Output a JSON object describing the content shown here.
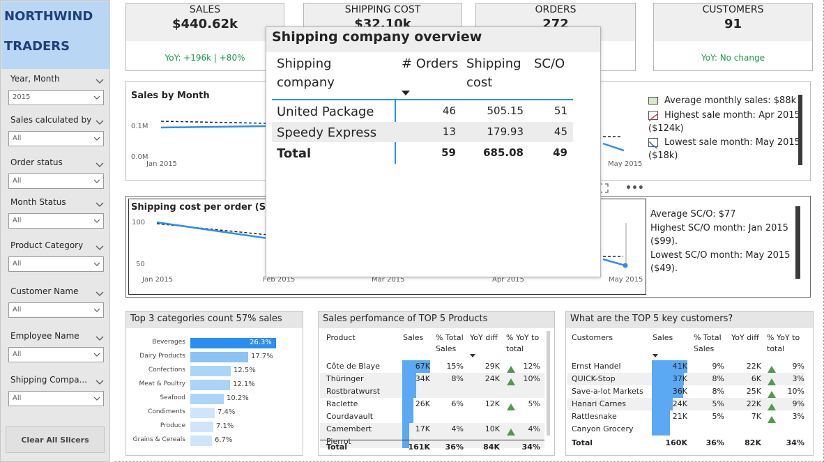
{
  "sidebar": {
    "logo_line1": "NORTHWIND",
    "logo_line2": "TRADERS",
    "slicers": [
      {
        "label": "Year, Month",
        "value": "2015"
      },
      {
        "label": "Sales calculated by",
        "value": "All"
      },
      {
        "label": "Order status",
        "value": "All"
      },
      {
        "label": "Month Status",
        "value": "All"
      },
      {
        "label": "Product Category",
        "value": "All"
      },
      {
        "label": "Customer Name",
        "value": "All"
      },
      {
        "label": "Employee Name",
        "value": "All"
      },
      {
        "label": "Shipping Compa...",
        "value": "All"
      }
    ],
    "clear_label": "Clear All Slicers"
  },
  "kpis": [
    {
      "label": "SALES",
      "value": "$440.62k",
      "sub": "YoY: +196k | +80%"
    },
    {
      "label": "SHIPPING COST",
      "value": "$32.10k",
      "sub": ""
    },
    {
      "label": "ORDERS",
      "value": "272",
      "sub": ""
    },
    {
      "label": "CUSTOMERS",
      "value": "91",
      "sub": "YoY: No change"
    }
  ],
  "sales_chart": {
    "title": "Sales by Month",
    "y_ticks": [
      "0.1M",
      "0.0M"
    ],
    "x_first": "Jan 2015",
    "x_last": "May 2015",
    "legend": {
      "avg": "Average monthly sales: $88k",
      "high": "Highest sale month: Apr 2015",
      "high2": "($124k)",
      "low": "Lowest sale month: May 2015",
      "low2": "($18k)"
    }
  },
  "sco_chart": {
    "title": "Shipping cost per order (SC/O)",
    "y_ticks": [
      "100",
      "50"
    ],
    "x_labels": [
      "Jan 2015",
      "Feb 2015",
      "Mar 2015",
      "Apr 2015",
      "May 2015"
    ],
    "legend": {
      "avg": "Average SC/O: $77",
      "high": "Highest SC/O month: Jan 2015",
      "high2": "($99).",
      "low": "Lowest SC/O month: May 2015",
      "low2": "($49)."
    }
  },
  "categories_card": {
    "title": "Top 3 categories count 57% sales",
    "rows": [
      {
        "name": "Beverages",
        "pct": "26.3%",
        "value": 26.3
      },
      {
        "name": "Dairy Products",
        "pct": "17.7%",
        "value": 17.7
      },
      {
        "name": "Confections",
        "pct": "12.5%",
        "value": 12.5
      },
      {
        "name": "Meat & Poultry",
        "pct": "12.1%",
        "value": 12.1
      },
      {
        "name": "Seafood",
        "pct": "10.2%",
        "value": 10.2
      },
      {
        "name": "Condiments",
        "pct": "7.4%",
        "value": 7.4
      },
      {
        "name": "Produce",
        "pct": "7.1%",
        "value": 7.1
      },
      {
        "name": "Grains & Cereals",
        "pct": "6.7%",
        "value": 6.7
      }
    ]
  },
  "products_card": {
    "title": "Sales perfomance of TOP 5 Products",
    "headers": [
      "Product",
      "Sales",
      "% Total Sales",
      "YoY diff",
      "% YoY to total"
    ],
    "rows": [
      {
        "name": "Côte de Blaye",
        "name2": "",
        "sales": "67K",
        "bar": 67,
        "pct": "15%",
        "yoy": "29K",
        "yoypct": "12%"
      },
      {
        "name": "Thüringer",
        "name2": "Rostbratwurst",
        "sales": "34K",
        "bar": 34,
        "pct": "8%",
        "yoy": "24K",
        "yoypct": "10%"
      },
      {
        "name": "Raclette",
        "name2": "Courdavault",
        "sales": "26K",
        "bar": 26,
        "pct": "6%",
        "yoy": "12K",
        "yoypct": "5%"
      },
      {
        "name": "Camembert",
        "name2": "Pierrot",
        "sales": "17K",
        "bar": 17,
        "pct": "4%",
        "yoy": "10K",
        "yoypct": "4%"
      }
    ],
    "total": {
      "label": "Total",
      "sales": "161K",
      "pct": "36%",
      "yoy": "84K",
      "yoypct": "34%"
    }
  },
  "customers_card": {
    "title": "What are the TOP 5 key customers?",
    "headers": [
      "Customers",
      "Sales",
      "% Total Sales",
      "YoY diff",
      "% YoY to total"
    ],
    "rows": [
      {
        "name": "Ernst Handel",
        "name2": "",
        "sales": "41K",
        "bar": 41,
        "pct": "9%",
        "yoy": "22K",
        "yoypct": "9%"
      },
      {
        "name": "QUICK-Stop",
        "name2": "",
        "sales": "37K",
        "bar": 37,
        "pct": "8%",
        "yoy": "6K",
        "yoypct": "3%"
      },
      {
        "name": "Save-a-lot Markets",
        "name2": "",
        "sales": "36K",
        "bar": 36,
        "pct": "8%",
        "yoy": "25K",
        "yoypct": "10%"
      },
      {
        "name": "Hanari Carnes",
        "name2": "",
        "sales": "24K",
        "bar": 24,
        "pct": "5%",
        "yoy": "22K",
        "yoypct": "9%"
      },
      {
        "name": "Rattlesnake",
        "name2": "Canyon Grocery",
        "sales": "21K",
        "bar": 21,
        "pct": "5%",
        "yoy": "7K",
        "yoypct": "3%"
      }
    ],
    "total": {
      "label": "Total",
      "sales": "160K",
      "pct": "36%",
      "yoy": "82K",
      "yoypct": "34%"
    }
  },
  "overlay": {
    "title": "Shipping company overview",
    "headers": {
      "company": "Shipping company",
      "orders": "# Orders",
      "cost": "Shipping cost",
      "sco": "SC/O"
    },
    "rows": [
      {
        "company": "United Package",
        "orders": "46",
        "cost": "505.15",
        "sco": "51"
      },
      {
        "company": "Speedy Express",
        "orders": "13",
        "cost": "179.93",
        "sco": "45"
      }
    ],
    "total": {
      "company": "Total",
      "orders": "59",
      "cost": "685.08",
      "sco": "49"
    }
  },
  "colors": {
    "accent": "#2b8ef0",
    "bar_light": "#a9d3f7",
    "green": "#1a9a4e"
  }
}
